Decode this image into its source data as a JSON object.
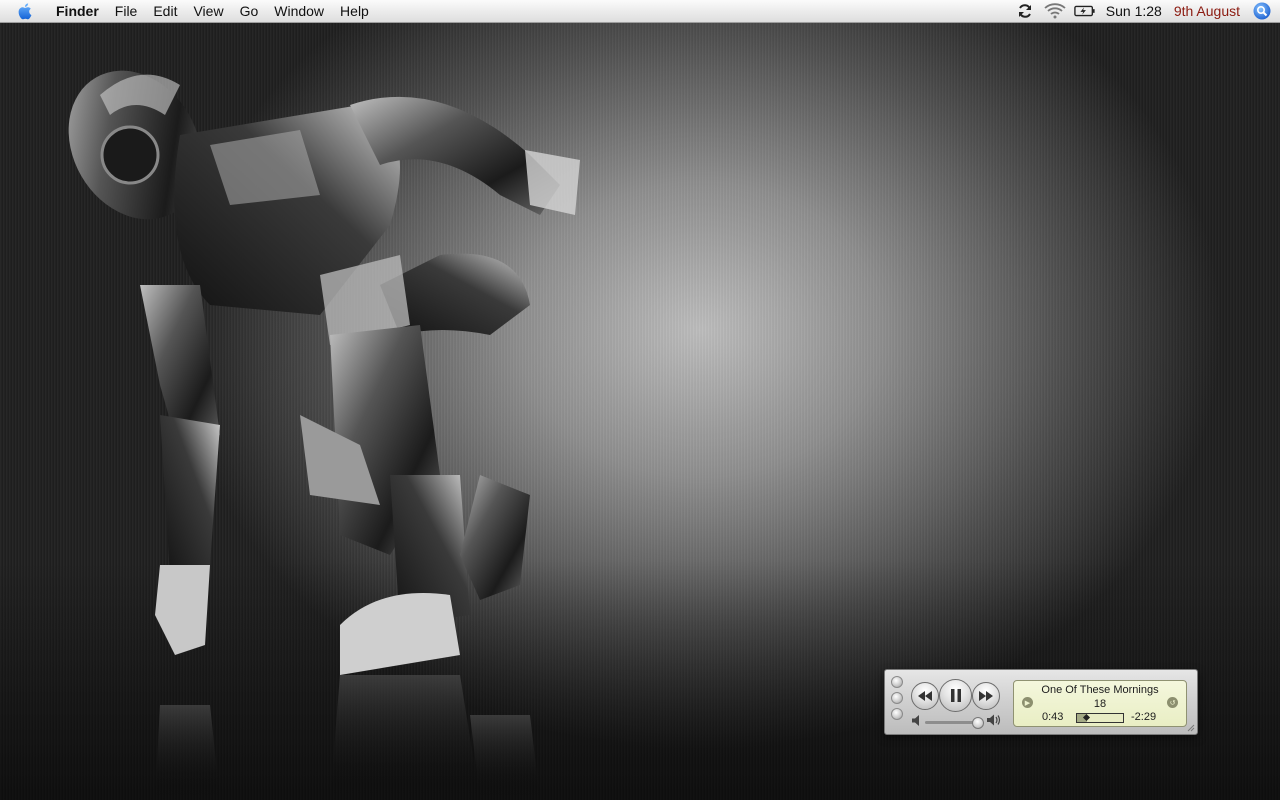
{
  "menubar": {
    "app_name": "Finder",
    "items": [
      "File",
      "Edit",
      "View",
      "Go",
      "Window",
      "Help"
    ],
    "clock": "Sun 1:28",
    "date": "9th August",
    "date_color": "#8b1a10",
    "icons": [
      "apple-icon",
      "sync-icon",
      "wifi-icon",
      "battery-icon",
      "spotlight-icon"
    ]
  },
  "desktop": {
    "wallpaper": "robot-figure"
  },
  "mini_player": {
    "song_title": "One Of These Mornings",
    "track_number": "18",
    "elapsed": "0:43",
    "remaining": "-2:29",
    "progress_fraction": 0.22,
    "volume_fraction": 0.9,
    "state": "playing",
    "lcd_color": "#e9eec4"
  }
}
